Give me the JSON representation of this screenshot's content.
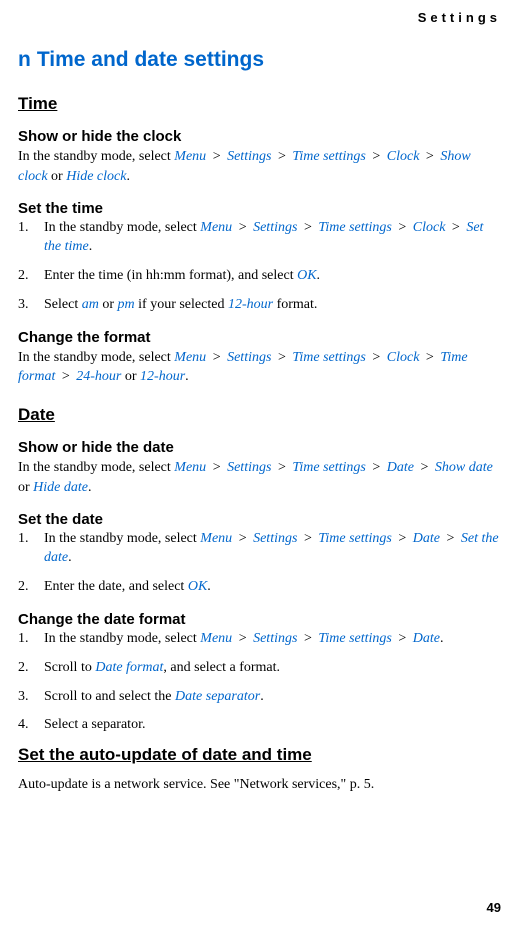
{
  "header": {
    "label": "Settings"
  },
  "pageNumber": "49",
  "mainTitle": {
    "bullet": "n",
    "text": "Time and date settings"
  },
  "sections": {
    "time": {
      "heading": "Time",
      "showHide": {
        "heading": "Show or hide the clock",
        "prefix": "In the standby mode, select ",
        "path": [
          "Menu",
          "Settings",
          "Time settings",
          "Clock",
          "Show clock"
        ],
        "connector": " or ",
        "alt": "Hide clock",
        "end": "."
      },
      "setTime": {
        "heading": "Set the time",
        "steps": {
          "s1": {
            "prefix": "In the standby mode, select ",
            "path": [
              "Menu",
              "Settings",
              "Time settings",
              "Clock",
              "Set the time"
            ],
            "end": "."
          },
          "s2": {
            "prefix": "Enter the time (in hh:mm format), and select ",
            "link": "OK",
            "end": "."
          },
          "s3": {
            "prefix": "Select ",
            "l1": "am",
            "mid1": " or ",
            "l2": "pm",
            "mid2": " if your selected ",
            "l3": "12-hour",
            "end": " format."
          }
        }
      },
      "changeFormat": {
        "heading": "Change the format",
        "prefix": "In the standby mode, select ",
        "path": [
          "Menu",
          "Settings",
          "Time settings",
          "Clock",
          "Time format",
          "24-hour"
        ],
        "connector": " or ",
        "alt": "12-hour",
        "end": "."
      }
    },
    "date": {
      "heading": "Date",
      "showHide": {
        "heading": "Show or hide the date",
        "prefix": "In the standby mode, select ",
        "path": [
          "Menu",
          "Settings",
          "Time settings",
          "Date",
          "Show date"
        ],
        "connector": " or ",
        "alt": "Hide date",
        "end": "."
      },
      "setDate": {
        "heading": "Set the date",
        "steps": {
          "s1": {
            "prefix": "In the standby mode, select ",
            "path": [
              "Menu",
              "Settings",
              "Time settings",
              "Date",
              "Set the date"
            ],
            "end": "."
          },
          "s2": {
            "prefix": "Enter the date, and select ",
            "link": "OK",
            "end": "."
          }
        }
      },
      "changeFormat": {
        "heading": "Change the date format",
        "steps": {
          "s1": {
            "prefix": "In the standby mode, select ",
            "path": [
              "Menu",
              "Settings",
              "Time settings",
              "Date"
            ],
            "end": "."
          },
          "s2": {
            "prefix": "Scroll to ",
            "link": "Date format",
            "end": ", and select a format."
          },
          "s3": {
            "prefix": "Scroll to and select the ",
            "link": "Date separator",
            "end": "."
          },
          "s4": {
            "text": "Select a separator."
          }
        }
      }
    },
    "autoUpdate": {
      "heading": "Set the auto-update of date and time",
      "text": "Auto-update is a network service. See \"Network services,\" p. 5."
    }
  }
}
